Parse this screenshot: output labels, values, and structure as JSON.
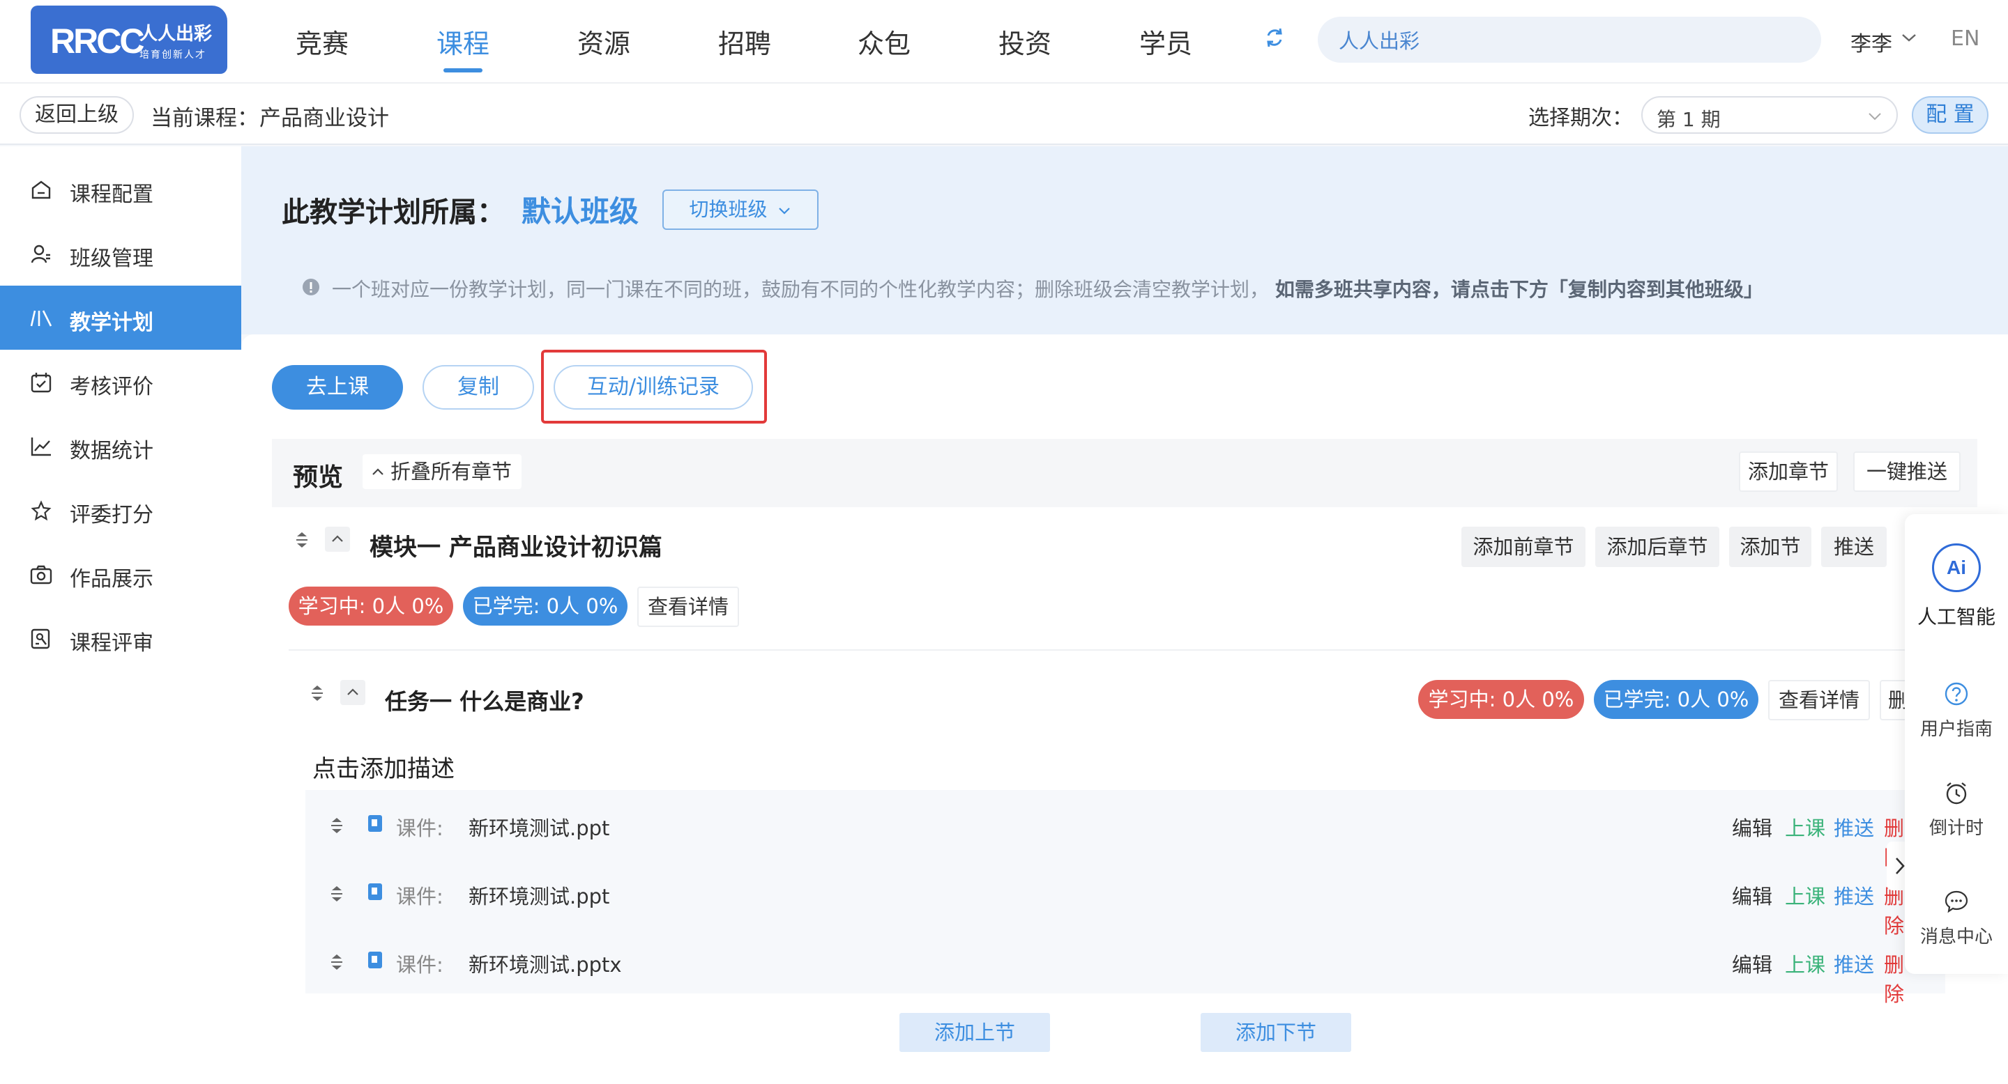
{
  "brand": {
    "logo_text": "RRCC",
    "logo_sub": "人人出彩",
    "logo_tagline": "培育创新人才",
    "color": "#3a6fd1"
  },
  "nav": {
    "items": [
      "竞赛",
      "课程",
      "资源",
      "招聘",
      "众包",
      "投资",
      "学员"
    ],
    "active": "课程",
    "search_value": "人人出彩",
    "user": "李李",
    "lang": "EN"
  },
  "crumb": {
    "back": "返回上级",
    "label": "当前课程：",
    "course": "产品商业设计",
    "period_label": "选择期次：",
    "period_value": "第 1 期",
    "config": "配 置"
  },
  "sidebar": {
    "items": [
      {
        "label": "课程配置",
        "icon": "home-icon"
      },
      {
        "label": "班级管理",
        "icon": "user-icon"
      },
      {
        "label": "教学计划",
        "icon": "plan-icon",
        "active": true
      },
      {
        "label": "考核评价",
        "icon": "calendar-check-icon"
      },
      {
        "label": "数据统计",
        "icon": "line-chart-icon"
      },
      {
        "label": "评委打分",
        "icon": "star-icon"
      },
      {
        "label": "作品展示",
        "icon": "camera-icon"
      },
      {
        "label": "课程评审",
        "icon": "review-icon"
      }
    ]
  },
  "plan": {
    "title": "此教学计划所属：",
    "class_name": "默认班级",
    "switch": "切换班级",
    "notice": "一个班对应一份教学计划，同一门课在不同的班，鼓励有不同的个性化教学内容；删除班级会清空教学计划，",
    "notice_strong": "如需多班共享内容，请点击下方「复制内容到其他班级」"
  },
  "actions": {
    "go_class": "去上课",
    "copy": "复制",
    "records": "互动/训练记录"
  },
  "preview": {
    "title": "预览",
    "collapse_all": "折叠所有章节",
    "add_chapter": "添加章节",
    "push_all": "一键推送"
  },
  "module": {
    "title": "模块一 产品商业设计初识篇",
    "buttons": [
      "添加前章节",
      "添加后章节",
      "添加节",
      "推送"
    ],
    "learning": "学习中: 0人 0%",
    "finished": "已学完: 0人 0%",
    "details": "查看详情"
  },
  "task": {
    "title": "任务一 什么是商业?",
    "learning": "学习中: 0人 0%",
    "finished": "已学完: 0人 0%",
    "details": "查看详情",
    "more": "删",
    "add_desc": "点击添加描述"
  },
  "lessons": [
    {
      "kind": "课件:",
      "file": "新环境测试.ppt"
    },
    {
      "kind": "课件:",
      "file": "新环境测试.ppt"
    },
    {
      "kind": "课件:",
      "file": "新环境测试.pptx"
    }
  ],
  "lesson_actions": {
    "edit": "编辑",
    "teach": "上课",
    "push": "推送",
    "delete": "删除"
  },
  "add_prev_section": "添加上节",
  "add_next_section": "添加下节",
  "right_bar": {
    "ai_badge": "Ai",
    "ai": "人工智能",
    "guide": "用户指南",
    "timer": "倒计时",
    "messages": "消息中心"
  },
  "colors": {
    "primary": "#3d8ee0",
    "danger": "#e2615a",
    "success": "#3bb37a",
    "highlight": "#e23a3a"
  }
}
